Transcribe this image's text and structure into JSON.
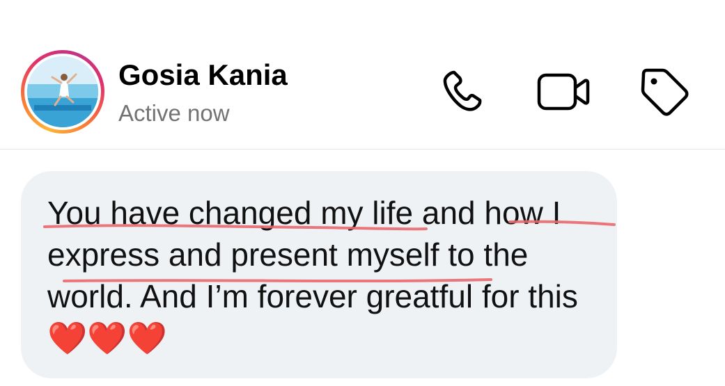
{
  "contact": {
    "name": "Gosia Kania",
    "status": "Active now",
    "avatar_icon": "profile-photo"
  },
  "actions": {
    "call_icon": "phone-icon",
    "video_icon": "video-camera-icon",
    "tag_icon": "tag-icon"
  },
  "message": {
    "text": "You have changed my life and how I express and present myself to the world. And I’m forever greatful for this",
    "emoji": "❤️❤️❤️"
  },
  "colors": {
    "underline": "#e8686d",
    "bubble": "#eff2f5",
    "status_gray": "#737373",
    "story_ring": [
      "#fdb437",
      "#e1306c",
      "#c13584"
    ]
  }
}
